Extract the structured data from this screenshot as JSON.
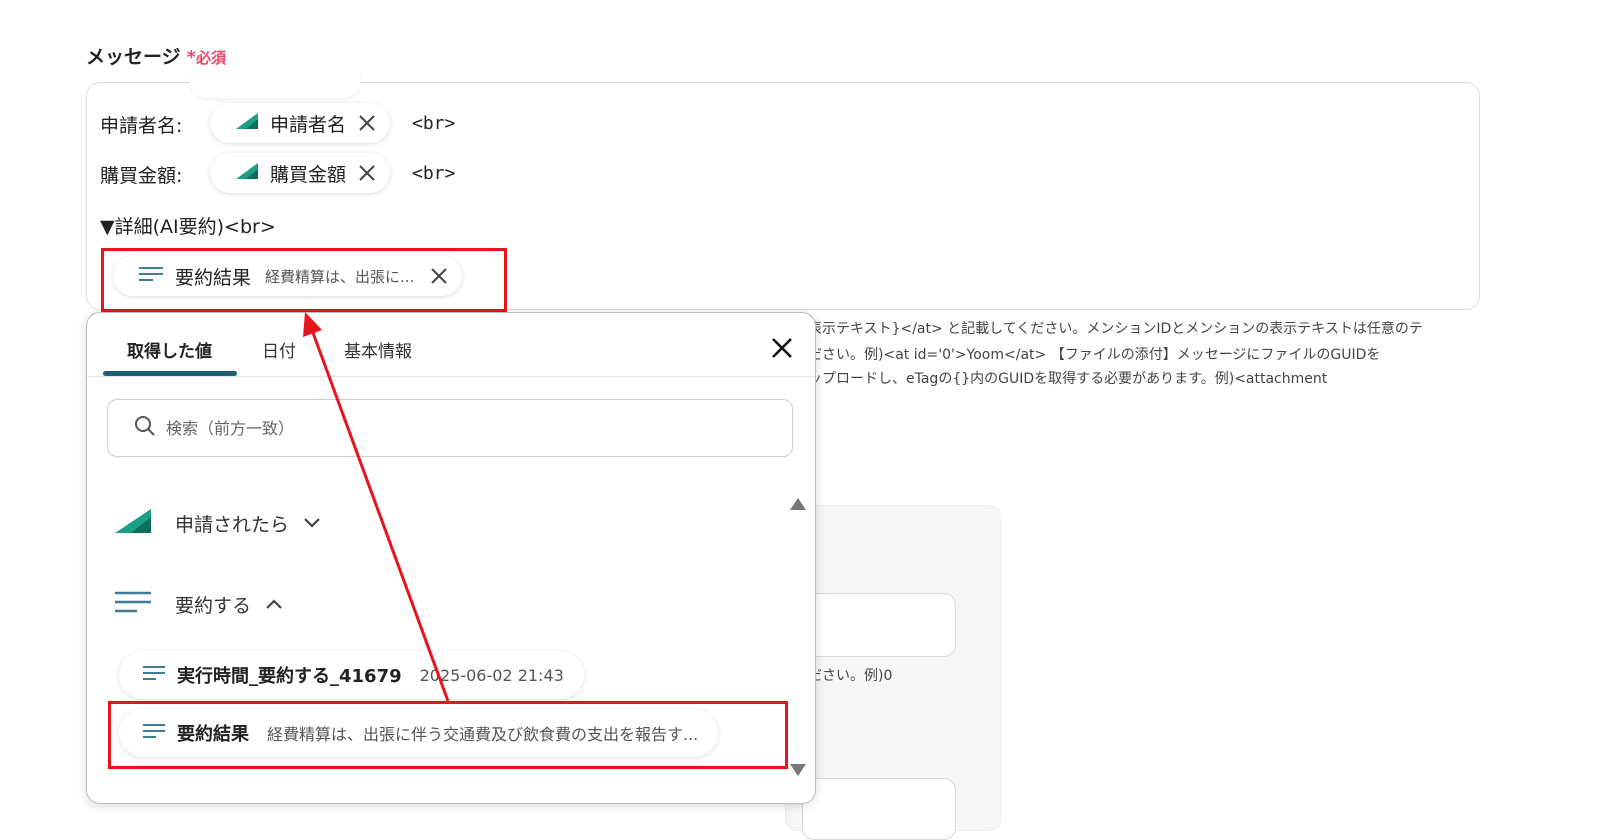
{
  "field": {
    "label": "メッセージ",
    "required_mark": "*",
    "required_text": "必須"
  },
  "message": {
    "line1_label": "申請者名:",
    "line1_chip": "申請者名",
    "line2_label": "購買金額:",
    "line2_chip": "購買金額",
    "br_tag": "<br>",
    "detail_label": "▼詳細(AI要約)<br>",
    "summary_chip_name": "要約結果",
    "summary_chip_preview": "経費精算は、出張に..."
  },
  "help_text": {
    "line1": "表示テキスト}</at> と記載してください。メンションIDとメンションの表示テキストは任意のテ",
    "line2": "ださい。例)<at id='0'>Yoom</at> 【ファイルの添付】メッセージにファイルのGUIDを",
    "line3": "ップロードし、eTagの{}内のGUIDを取得する必要があります。例)<attachment",
    "line4": "ださい。例)0"
  },
  "popup": {
    "tabs": [
      {
        "label": "取得した値",
        "active": true
      },
      {
        "label": "日付",
        "active": false
      },
      {
        "label": "基本情報",
        "active": false
      }
    ],
    "search_placeholder": "検索（前方一致）",
    "groups": [
      {
        "label": "申請されたら",
        "icon": "triangle-logo-icon",
        "expanded": false
      },
      {
        "label": "要約する",
        "icon": "text-lines-icon",
        "expanded": true
      }
    ],
    "items": [
      {
        "name": "実行時間_要約する_41679",
        "value": "2025-06-02 21:43"
      },
      {
        "name": "要約結果",
        "value": "経費精算は、出張に伴う交通費及び飲食費の支出を報告す..."
      }
    ]
  },
  "colors": {
    "required": "#e8476b",
    "highlight": "#e8141c",
    "tab_underline": "#1e5f74",
    "logo_green": "#1aa085",
    "lines_icon": "#3f7c94"
  }
}
